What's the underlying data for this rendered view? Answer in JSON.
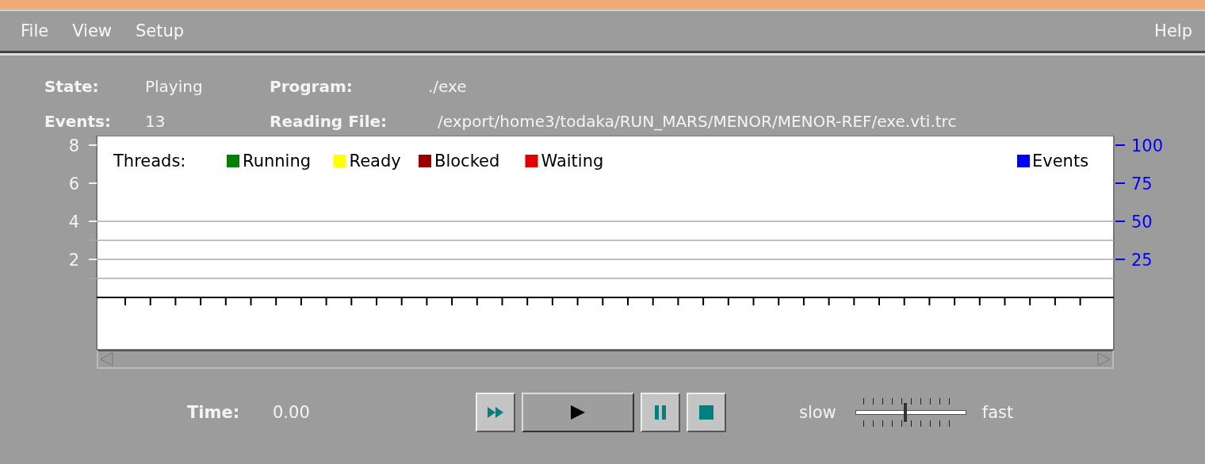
{
  "menu": [
    {
      "label": "File"
    },
    {
      "label": "View"
    },
    {
      "label": "Setup"
    }
  ],
  "help_menu": {
    "label": "Help"
  },
  "info": {
    "state_label": "State:",
    "state": "Playing",
    "program_label": "Program:",
    "program": "./exe",
    "events_label": "Events:",
    "events": "13",
    "file_label": "Reading File:",
    "file": "/export/home3/todaka/RUN_MARS/MENOR/MENOR-REF/exe.vti.trc"
  },
  "chart_data": {
    "type": "line",
    "legend_title": "Threads:",
    "ylim": [
      -2.75,
      8.5
    ],
    "yticks": [
      2,
      4,
      6,
      8
    ],
    "y2lim": [
      -34.375,
      106.25
    ],
    "y2ticks": [
      25,
      50,
      75,
      100
    ],
    "series": [
      {
        "name": "Running",
        "color": "#008000"
      },
      {
        "name": "Ready",
        "color": "#ffff00"
      },
      {
        "name": "Blocked",
        "color": "#990000"
      },
      {
        "name": "Waiting",
        "color": "#e00000"
      },
      {
        "name": "Events",
        "color": "#0000ff",
        "axis": "y2"
      }
    ]
  },
  "time": {
    "label": "Time:",
    "value": "0.00"
  },
  "controls": [
    {
      "kind": "fast_forward"
    },
    {
      "kind": "play"
    },
    {
      "kind": "pause"
    },
    {
      "kind": "stop"
    }
  ],
  "speed": {
    "min_label": "slow",
    "max_label": "fast",
    "level": 0.45
  }
}
